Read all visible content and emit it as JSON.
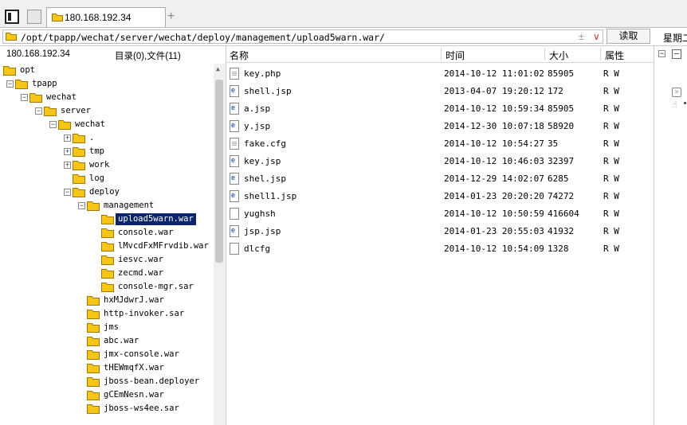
{
  "tab": {
    "title": "180.168.192.34"
  },
  "address": {
    "path": "/opt/tpapp/wechat/server/wechat/deploy/management/upload5warn.war/",
    "pm_glyph": "±",
    "dropdown_glyph": "∨",
    "read_button": "读取",
    "week_label": "星期二"
  },
  "left_panel": {
    "host": "180.168.192.34",
    "count": "目录(0),文件(11)"
  },
  "tree": [
    {
      "label": "opt",
      "depth": 0,
      "box": ""
    },
    {
      "label": "tpapp",
      "depth": 0,
      "box": "−"
    },
    {
      "label": "wechat",
      "depth": 1,
      "box": "−"
    },
    {
      "label": "server",
      "depth": 2,
      "box": "−"
    },
    {
      "label": "wechat",
      "depth": 3,
      "box": "−"
    },
    {
      "label": ".",
      "depth": 4,
      "box": "+"
    },
    {
      "label": "tmp",
      "depth": 4,
      "box": "+"
    },
    {
      "label": "work",
      "depth": 4,
      "box": "+"
    },
    {
      "label": "log",
      "depth": 4,
      "box": ""
    },
    {
      "label": "deploy",
      "depth": 4,
      "box": "−"
    },
    {
      "label": "management",
      "depth": 5,
      "box": "−"
    },
    {
      "label": "upload5warn.war",
      "depth": 6,
      "box": "",
      "selected": true
    },
    {
      "label": "console.war",
      "depth": 6,
      "box": ""
    },
    {
      "label": "lMvcdFxMFrvdib.war",
      "depth": 6,
      "box": ""
    },
    {
      "label": "iesvc.war",
      "depth": 6,
      "box": ""
    },
    {
      "label": "zecmd.war",
      "depth": 6,
      "box": ""
    },
    {
      "label": "console-mgr.sar",
      "depth": 6,
      "box": ""
    },
    {
      "label": "hxMJdwrJ.war",
      "depth": 5,
      "box": ""
    },
    {
      "label": "http-invoker.sar",
      "depth": 5,
      "box": ""
    },
    {
      "label": "jms",
      "depth": 5,
      "box": ""
    },
    {
      "label": "abc.war",
      "depth": 5,
      "box": ""
    },
    {
      "label": "jmx-console.war",
      "depth": 5,
      "box": ""
    },
    {
      "label": "tHEWmqfX.war",
      "depth": 5,
      "box": ""
    },
    {
      "label": "jboss-bean.deployer",
      "depth": 5,
      "box": ""
    },
    {
      "label": "gCEmNesn.war",
      "depth": 5,
      "box": ""
    },
    {
      "label": "jboss-ws4ee.sar",
      "depth": 5,
      "box": ""
    }
  ],
  "list_headers": {
    "name": "名称",
    "time": "时间",
    "size": "大小",
    "attr": "属性"
  },
  "files": [
    {
      "name": "key.php",
      "time": "2014-10-12 11:01:02",
      "size": "85905",
      "attr": "R W",
      "icon": "doc"
    },
    {
      "name": "shell.jsp",
      "time": "2013-04-07 19:20:12",
      "size": "172",
      "attr": "R W",
      "icon": "web"
    },
    {
      "name": "a.jsp",
      "time": "2014-10-12 10:59:34",
      "size": "85905",
      "attr": "R W",
      "icon": "web"
    },
    {
      "name": "y.jsp",
      "time": "2014-12-30 10:07:18",
      "size": "58920",
      "attr": "R W",
      "icon": "web"
    },
    {
      "name": "fake.cfg",
      "time": "2014-10-12 10:54:27",
      "size": "35",
      "attr": "R W",
      "icon": "doc"
    },
    {
      "name": "key.jsp",
      "time": "2014-10-12 10:46:03",
      "size": "32397",
      "attr": "R W",
      "icon": "web"
    },
    {
      "name": "shel.jsp",
      "time": "2014-12-29 14:02:07",
      "size": "6285",
      "attr": "R W",
      "icon": "web"
    },
    {
      "name": "shell1.jsp",
      "time": "2014-01-23 20:20:20",
      "size": "74272",
      "attr": "R W",
      "icon": "web"
    },
    {
      "name": "yughsh",
      "time": "2014-10-12 10:50:59",
      "size": "416604",
      "attr": "R W",
      "icon": "blank"
    },
    {
      "name": "jsp.jsp",
      "time": "2014-01-23 20:55:03",
      "size": "41932",
      "attr": "R W",
      "icon": "web"
    },
    {
      "name": "dlcfg",
      "time": "2014-10-12 10:54:09",
      "size": "1328",
      "attr": "R W",
      "icon": "blank"
    }
  ],
  "right_panel": {
    "box_glyph": "−"
  },
  "colors": {
    "folder": "#f5c518",
    "selection": "#0a246a"
  }
}
